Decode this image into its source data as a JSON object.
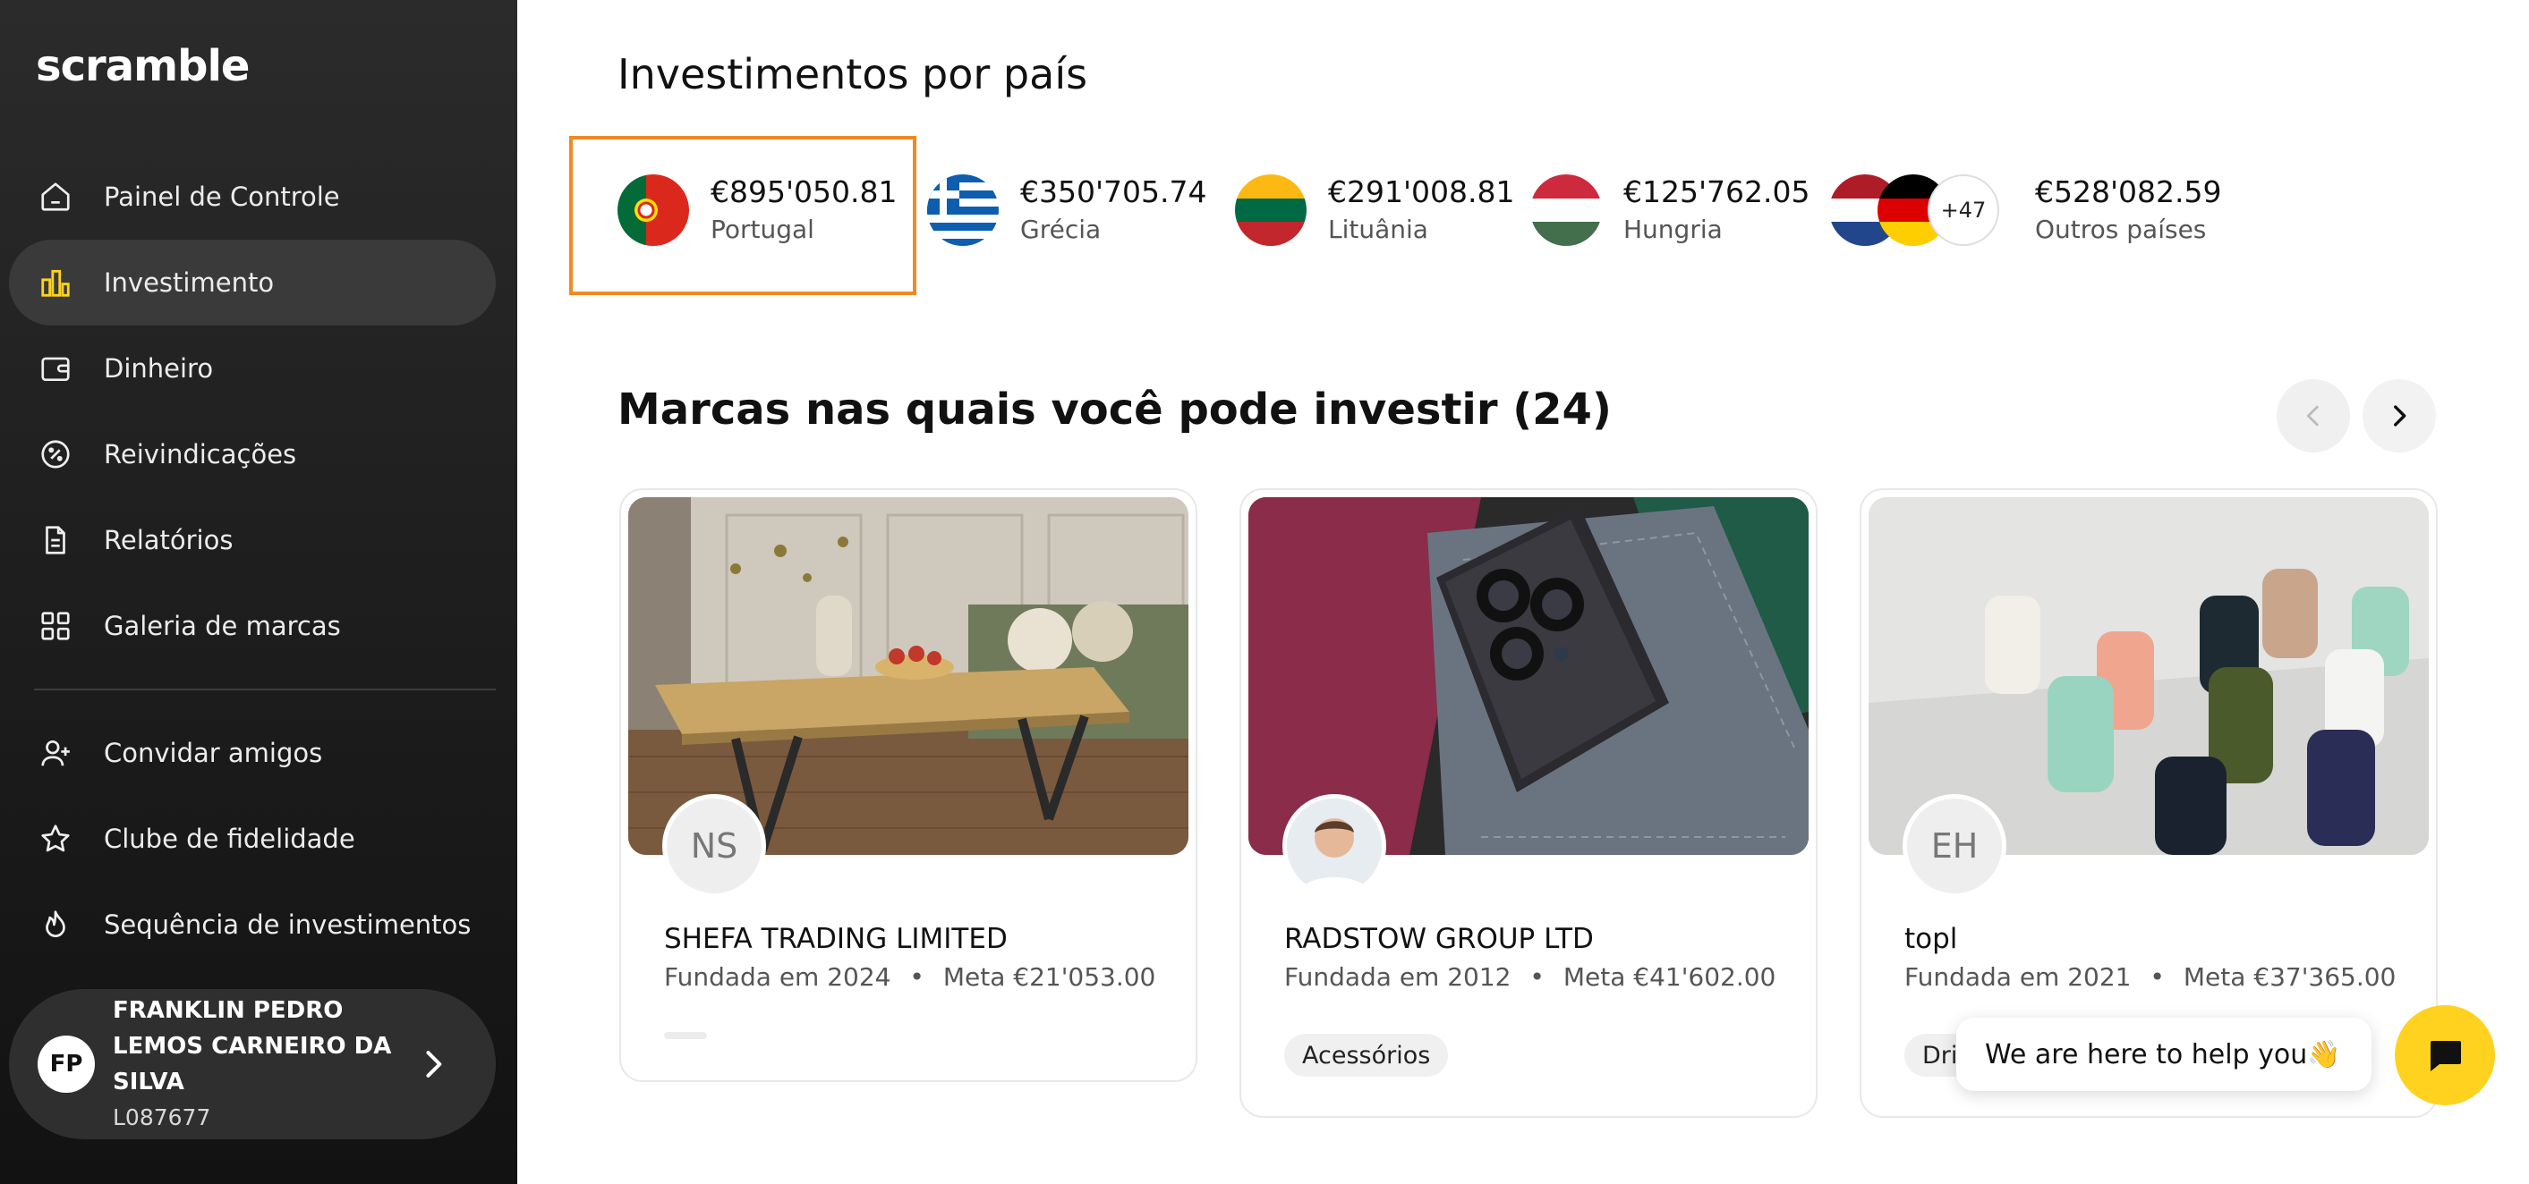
{
  "app": {
    "logo": "scramble"
  },
  "sidebar": {
    "items": [
      {
        "label": "Painel de Controle",
        "icon": "home-icon"
      },
      {
        "label": "Investimento",
        "icon": "bar-chart-icon",
        "active": true
      },
      {
        "label": "Dinheiro",
        "icon": "wallet-icon"
      },
      {
        "label": "Reivindicações",
        "icon": "percent-icon"
      },
      {
        "label": "Relatórios",
        "icon": "document-icon"
      },
      {
        "label": "Galeria de marcas",
        "icon": "grid-icon"
      },
      {
        "label": "Convidar amigos",
        "icon": "add-user-icon"
      },
      {
        "label": "Clube de fidelidade",
        "icon": "star-icon"
      },
      {
        "label": "Sequência de investimentos",
        "icon": "flame-icon"
      }
    ],
    "user": {
      "initials": "FP",
      "name": "FRANKLIN PEDRO LEMOS CARNEIRO DA SILVA",
      "id": "L087677"
    }
  },
  "countries_section": {
    "title": "Investimentos por país",
    "countries": [
      {
        "amount": "€895'050.81",
        "name": "Portugal",
        "flag": "portugal-flag"
      },
      {
        "amount": "€350'705.74",
        "name": "Grécia",
        "flag": "greece-flag"
      },
      {
        "amount": "€291'008.81",
        "name": "Lituânia",
        "flag": "lithuania-flag"
      },
      {
        "amount": "€125'762.05",
        "name": "Hungria",
        "flag": "hungary-flag"
      },
      {
        "amount": "€528'082.59",
        "name": "Outros países",
        "more": "+47"
      }
    ]
  },
  "brands_section": {
    "title": "Marcas nas quais você pode investir (24)",
    "cards": [
      {
        "initials": "NS",
        "name": "SHEFA TRADING LIMITED",
        "founded": "Fundada em 2024",
        "goal": "Meta €21'053.00",
        "tag": ""
      },
      {
        "initials": "",
        "name": "RADSTOW GROUP LTD",
        "founded": "Fundada em 2012",
        "goal": "Meta €41'602.00",
        "tag": "Acessórios"
      },
      {
        "initials": "EH",
        "name": "topl",
        "founded": "Fundada em 2021",
        "goal": "Meta €37'365.00",
        "tag": "Dri"
      }
    ]
  },
  "chat": {
    "bubble": "We are here to help you👋"
  },
  "colors": {
    "accent": "#ffd21f",
    "highlight": "#f08a24",
    "sidebar_bg": "#1f1f1f"
  }
}
